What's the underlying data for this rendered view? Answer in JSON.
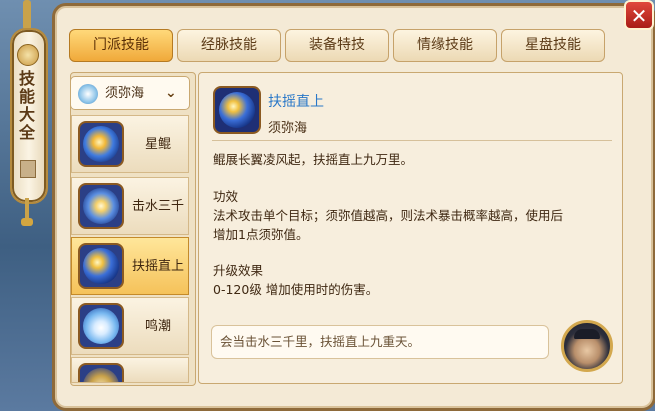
{
  "scroll": {
    "title": "技能大全"
  },
  "tabs": [
    {
      "label": "门派技能",
      "active": true
    },
    {
      "label": "经脉技能",
      "active": false
    },
    {
      "label": "装备特技",
      "active": false
    },
    {
      "label": "情缘技能",
      "active": false
    },
    {
      "label": "星盘技能",
      "active": false
    }
  ],
  "school_selector": {
    "value": "须弥海"
  },
  "skills": [
    {
      "name": "星鲲",
      "active": false
    },
    {
      "name": "击水三千",
      "active": false
    },
    {
      "name": "扶摇直上",
      "active": true
    },
    {
      "name": "鸣潮",
      "active": false
    }
  ],
  "detail": {
    "name": "扶摇直上",
    "school": "须弥海",
    "flavor": "鲲展长翼凌风起，扶摇直上九万里。",
    "effect_heading": "功效",
    "effect_line1": "法术攻击单个目标；须弥值越高，则法术暴击概率越高，使用后",
    "effect_line2": "增加1点须弥值。",
    "upgrade_heading": "升级效果",
    "upgrade_text": "0-120级 增加使用时的伤害。",
    "speech": "会当击水三千里，扶摇直上九重天。"
  },
  "icons": {
    "close": "close-icon",
    "chevron": "chevron-down-icon"
  }
}
